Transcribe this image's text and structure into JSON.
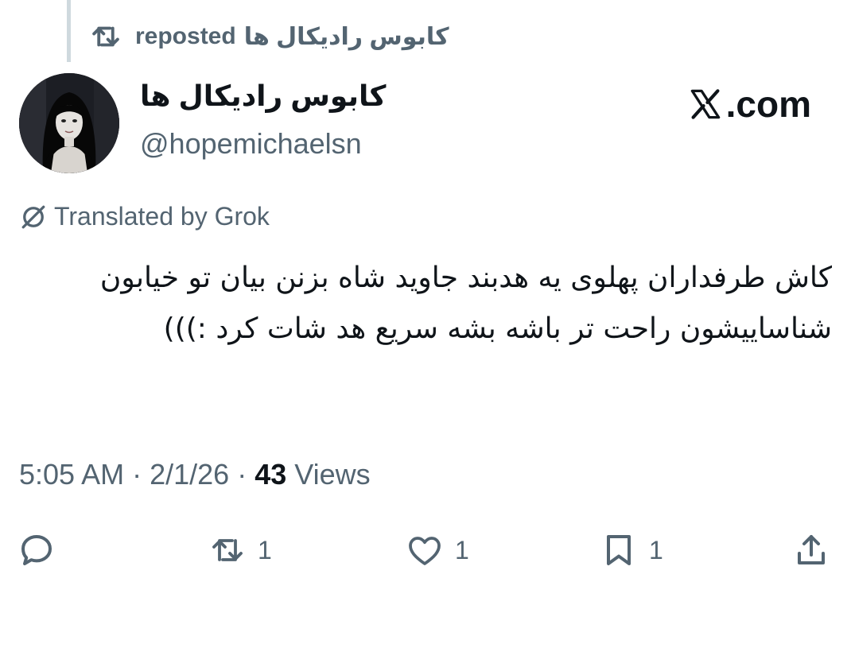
{
  "repost_banner": {
    "reposter_name": "کابوس رادیکال ها",
    "label": "reposted",
    "icon": "repost-icon"
  },
  "author": {
    "display_name": "کابوس رادیکال ها",
    "handle": "@hopemichaelsn",
    "avatar": "avatar-photo"
  },
  "source": {
    "site_label": ".com",
    "logo": "x-logo-icon"
  },
  "translation": {
    "label": "Translated by Grok",
    "icon": "grok-icon"
  },
  "tweet": {
    "text": "کاش طرفداران پهلوی یه هدبند جاوید شاه بزنن بیان تو خیابون شناساییشون راحت تر باشه بشه سریع هد شات کرد :)))"
  },
  "meta": {
    "time": "5:05 AM",
    "separator": " · ",
    "date": "2/1/26",
    "views_count": "43",
    "views_label": "Views"
  },
  "actions": {
    "reply": {
      "icon": "reply-icon",
      "count": ""
    },
    "repost": {
      "icon": "repost-icon",
      "count": "1"
    },
    "like": {
      "icon": "heart-icon",
      "count": "1"
    },
    "bookmark": {
      "icon": "bookmark-icon",
      "count": "1"
    },
    "share": {
      "icon": "share-icon"
    }
  },
  "colors": {
    "primary_text": "#0f1419",
    "secondary_text": "#536471",
    "thread_line": "#cfd9de",
    "background": "#ffffff"
  }
}
